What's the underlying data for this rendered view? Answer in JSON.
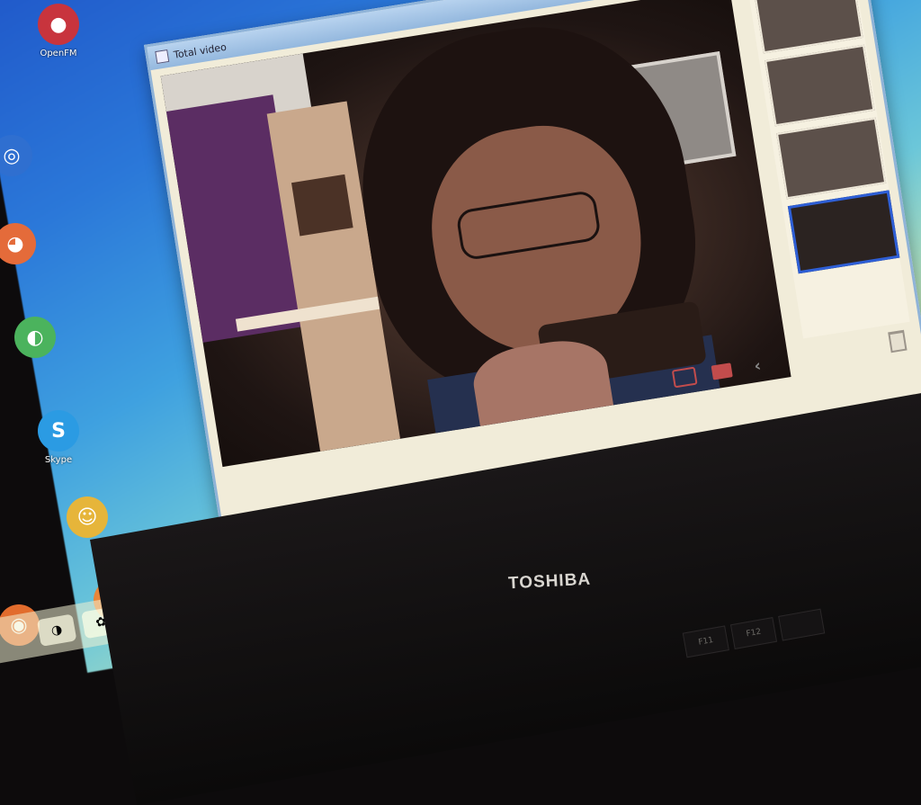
{
  "desktop": {
    "icons": [
      {
        "label": "OpenFM",
        "glyph": "●",
        "color": "#c8343d"
      },
      {
        "label": "",
        "glyph": "◎",
        "color": "#2f6fd0"
      },
      {
        "label": "",
        "glyph": "◕",
        "color": "#e46b3a"
      },
      {
        "label": "",
        "glyph": "◐",
        "color": "#4bb35d"
      },
      {
        "label": "Skype",
        "glyph": "S",
        "color": "#2b9be3"
      },
      {
        "label": "",
        "glyph": "☺",
        "color": "#e6b53a"
      },
      {
        "label": "",
        "glyph": "✺",
        "color": "#e8853a"
      },
      {
        "label": "",
        "glyph": "◉",
        "color": "#e26c2d"
      }
    ]
  },
  "window": {
    "title": "Total video",
    "status_field": "",
    "thumbnails": 4,
    "selected_thumbnail": 4
  },
  "taskbar": {
    "buttons": [
      "◑",
      "✿",
      "◧"
    ]
  },
  "laptop": {
    "brand": "TOSHIBA",
    "keys": [
      "F11",
      "F12",
      ""
    ]
  },
  "colors": {
    "accent": "#2e5fd6",
    "record": "#c24c4c"
  }
}
